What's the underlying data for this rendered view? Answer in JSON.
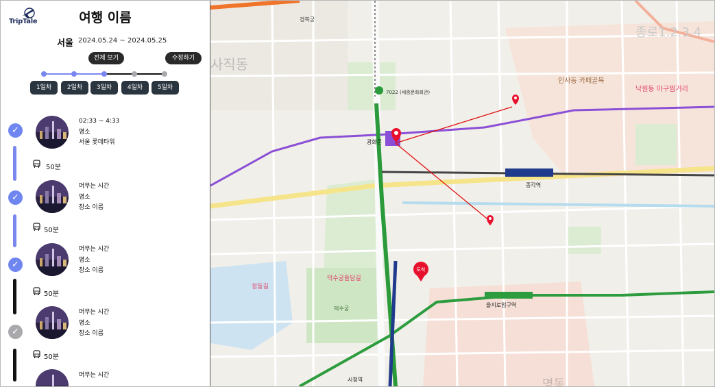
{
  "app": {
    "logo_text": "TripTale"
  },
  "trip": {
    "title": "여행 이름",
    "city": "서울",
    "dates": "2024.05.24 ~ 2024.05.25",
    "view_all_label": "전체 보기",
    "edit_label": "수정하기"
  },
  "days": [
    {
      "label": "1일차"
    },
    {
      "label": "2일차"
    },
    {
      "label": "3일차"
    },
    {
      "label": "4일차"
    },
    {
      "label": "5일차"
    }
  ],
  "progress": {
    "completed_days": 3,
    "total_days": 5
  },
  "colors": {
    "accent": "#6f86f0",
    "dark": "#2a2a2a",
    "day_button": "#2b3540",
    "done": "#6f86f0",
    "pending": "#a9a9ad",
    "route_line": "#e01010",
    "marker": "#e8112d"
  },
  "schedule": [
    {
      "time": "02:33 ~ 4:33",
      "place": "명소",
      "name": "서울 롯데타워",
      "status": "done"
    },
    {
      "time": "머무는 시간",
      "place": "명소",
      "name": "장소 이름",
      "status": "done"
    },
    {
      "time": "머무는 시간",
      "place": "명소",
      "name": "장소 이름",
      "status": "done"
    },
    {
      "time": "머무는 시간",
      "place": "명소",
      "name": "장소 이름",
      "status": "pending"
    },
    {
      "time": "머무는 시간"
    }
  ],
  "transits": [
    {
      "duration": "50분",
      "icon": "bus-icon"
    },
    {
      "duration": "50분",
      "icon": "bus-icon"
    },
    {
      "duration": "50분",
      "icon": "bus-icon"
    },
    {
      "duration": "50분",
      "icon": "bus-icon"
    }
  ],
  "map": {
    "labels": {
      "district_sajik": "사직동",
      "district_jongno": "종로1.2.3.4",
      "insadong": "인사동\n카페골목",
      "nakwon": "낙원동\n아구찜거리",
      "myeongdong": "명동",
      "station_bus": "7022 (세종문화회관)",
      "gwanghwamun": "경복궁",
      "deoksugung": "덕수궁",
      "deoksugung_wall": "덕수궁돌담길",
      "jeongdong": "정동길",
      "seoul_city_hall": "시청역",
      "jonggak": "종각역",
      "euljiro": "을지로입구역",
      "gwanghwamun_station": "광화문",
      "destination_badge": "도착"
    }
  }
}
